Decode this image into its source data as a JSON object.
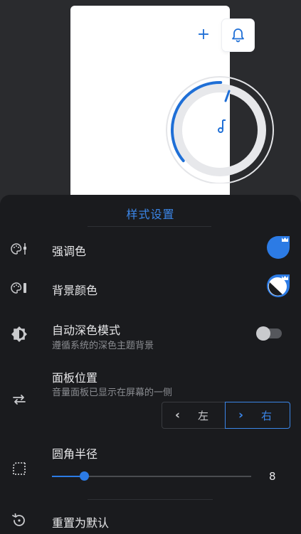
{
  "preview": {
    "plus_icon": "plus-icon",
    "bell_icon": "bell-icon",
    "music_icon": "music-note-icon",
    "volume_fraction": 0.35,
    "accent_color": "#1f6fd6"
  },
  "sheet": {
    "title": "样式设置",
    "accent_color": {
      "label": "强调色",
      "icon": "palette-slider-icon",
      "value_color": "#2c7be5",
      "badge_icon": "crown-icon"
    },
    "background_color": {
      "label": "背景颜色",
      "icon": "palette-bar-icon",
      "value_color": "#ffffff",
      "badge_icon": "crown-icon"
    },
    "auto_dark": {
      "label": "自动深色模式",
      "subtitle": "遵循系统的深色主题背景",
      "icon": "brightness-auto-icon",
      "enabled": false
    },
    "panel_position": {
      "label": "面板位置",
      "subtitle": "音量面板已显示在屏幕的一侧",
      "icon": "swap-horizontal-icon",
      "options": [
        {
          "label": "左",
          "chevron": "‹"
        },
        {
          "label": "右",
          "chevron": "›"
        }
      ],
      "selected": "右"
    },
    "corner_radius": {
      "label": "圆角半径",
      "icon": "rounded-corner-icon",
      "value": "8",
      "fraction": 0.16
    },
    "reset": {
      "label": "重置为默认",
      "icon": "restore-icon"
    }
  }
}
